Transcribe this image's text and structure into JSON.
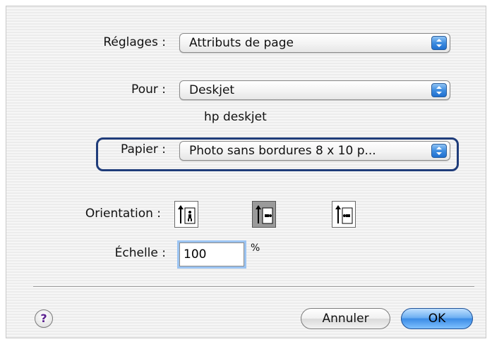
{
  "settings": {
    "label": "Réglages :",
    "value": "Attributs de page"
  },
  "format_for": {
    "label": "Pour :",
    "value": "Deskjet",
    "printer_name": "hp deskjet"
  },
  "paper": {
    "label": "Papier :",
    "value": "Photo sans bordures 8 x 10 p..."
  },
  "orientation": {
    "label": "Orientation :",
    "options": [
      {
        "icon": "portrait-orientation-icon",
        "selected": false
      },
      {
        "icon": "landscape-left-orientation-icon",
        "selected": true
      },
      {
        "icon": "landscape-right-orientation-icon",
        "selected": false
      }
    ]
  },
  "scale": {
    "label": "Échelle :",
    "value": "100",
    "unit": "%"
  },
  "footer": {
    "help_label": "?",
    "cancel_label": "Annuler",
    "ok_label": "OK"
  },
  "colors": {
    "popup_arrow_blue": "#3f8de0",
    "highlight_border": "#1f3c7a",
    "ok_button_blue": "#6eb0f2"
  }
}
